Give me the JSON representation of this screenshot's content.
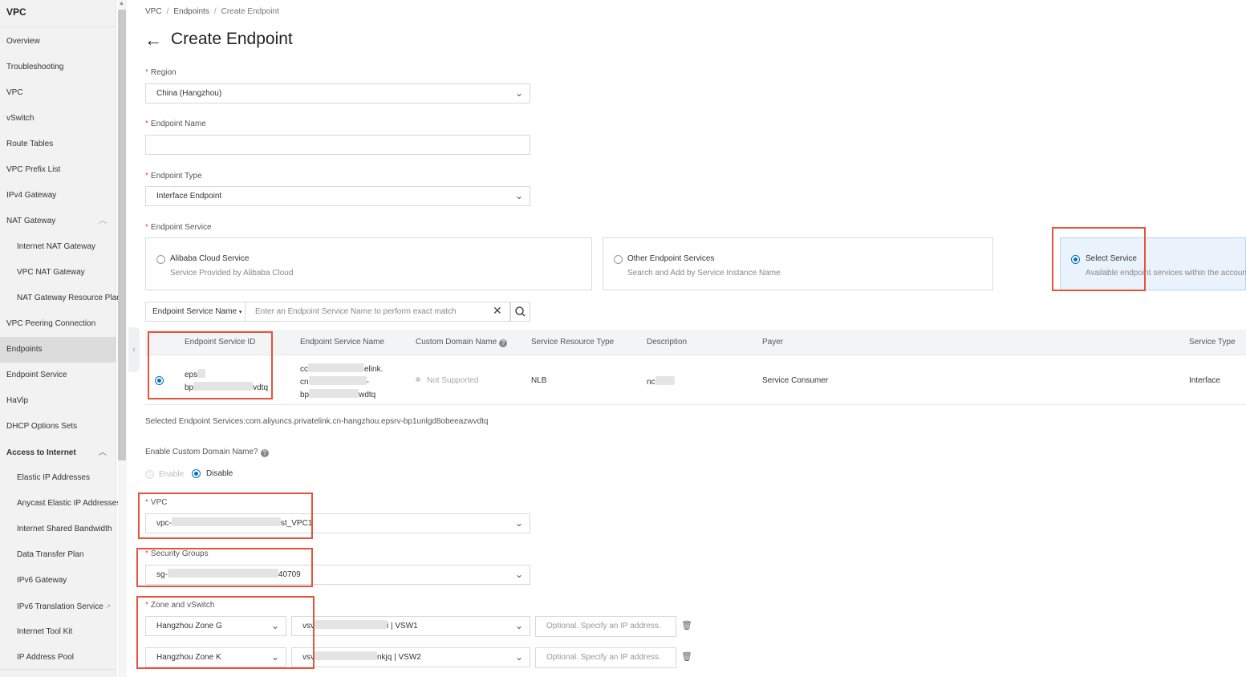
{
  "sidebar": {
    "title": "VPC",
    "items": [
      {
        "label": "Overview"
      },
      {
        "label": "Troubleshooting"
      },
      {
        "label": "VPC"
      },
      {
        "label": "vSwitch"
      },
      {
        "label": "Route Tables"
      },
      {
        "label": "VPC Prefix List"
      },
      {
        "label": "IPv4 Gateway"
      },
      {
        "label": "NAT Gateway"
      },
      {
        "label": "Internet NAT Gateway"
      },
      {
        "label": "VPC NAT Gateway"
      },
      {
        "label": "NAT Gateway Resource Plan"
      },
      {
        "label": "VPC Peering Connection"
      },
      {
        "label": "Endpoints"
      },
      {
        "label": "Endpoint Service"
      },
      {
        "label": "HaVip"
      },
      {
        "label": "DHCP Options Sets"
      },
      {
        "label": "Access to Internet"
      },
      {
        "label": "Elastic IP Addresses"
      },
      {
        "label": "Anycast Elastic IP Addresses"
      },
      {
        "label": "Internet Shared Bandwidth"
      },
      {
        "label": "Data Transfer Plan"
      },
      {
        "label": "IPv6 Gateway"
      },
      {
        "label": "IPv6 Translation Service"
      },
      {
        "label": "Internet Tool Kit"
      },
      {
        "label": "IP Address Pool"
      }
    ]
  },
  "breadcrumb": [
    "VPC",
    "Endpoints",
    "Create Endpoint"
  ],
  "page": {
    "title": "Create Endpoint"
  },
  "form": {
    "region": {
      "label": "Region",
      "value": "China (Hangzhou)"
    },
    "endpoint_name": {
      "label": "Endpoint Name",
      "value": ""
    },
    "endpoint_type": {
      "label": "Endpoint Type",
      "value": "Interface Endpoint"
    },
    "endpoint_service": {
      "label": "Endpoint Service",
      "options": [
        {
          "title": "Alibaba Cloud Service",
          "desc": "Service Provided by Alibaba Cloud",
          "selected": false
        },
        {
          "title": "Other Endpoint Services",
          "desc": "Search and Add by Service Instance Name",
          "selected": false
        },
        {
          "title": "Select Service",
          "desc": "Available endpoint services within the account",
          "selected": true
        }
      ]
    },
    "search": {
      "filter": "Endpoint Service Name",
      "placeholder": "Enter an Endpoint Service Name to perform exact match"
    },
    "table": {
      "columns": [
        "Endpoint Service ID",
        "Endpoint Service Name",
        "Custom Domain Name",
        "Service Resource Type",
        "Description",
        "Payer",
        "Service Type"
      ],
      "row": {
        "id_line1": "eps",
        "id_line2_a": "bp",
        "id_line2_b": "vdtq",
        "name_line1_a": "cc",
        "name_line1_b": "elink.",
        "name_line2_a": "cn",
        "name_line2_b": "-",
        "name_line3_a": "bp",
        "name_line3_b": "wdtq",
        "custom_domain": "Not Supported",
        "resource_type": "NLB",
        "description": "nc",
        "payer": "Service Consumer",
        "service_type": "Interface"
      }
    },
    "selected_services": "Selected Endpoint Services:com.aliyuncs.privatelink.cn-hangzhou.epsrv-bp1unlgd8obeeazwvdtq",
    "custom_domain": {
      "label": "Enable Custom Domain Name?",
      "enable": "Enable",
      "disable": "Disable"
    },
    "vpc": {
      "label": "VPC",
      "value_a": "vpc-",
      "value_b": "st_VPC1"
    },
    "security_groups": {
      "label": "Security Groups",
      "value_a": "sg-",
      "value_b": "40709"
    },
    "zones": {
      "label": "Zone and vSwitch",
      "rows": [
        {
          "zone": "Hangzhou Zone G",
          "vswitch_a": "vsv",
          "vswitch_b": "i | VSW1",
          "ip_placeholder": "Optional. Specify an IP address."
        },
        {
          "zone": "Hangzhou Zone K",
          "vswitch_a": "vsv",
          "vswitch_b": "nkjq | VSW2",
          "ip_placeholder": "Optional. Specify an IP address."
        }
      ]
    }
  },
  "colors": {
    "accent": "#0070cc",
    "highlight": "#e5533a",
    "required": "#e34d4d"
  }
}
